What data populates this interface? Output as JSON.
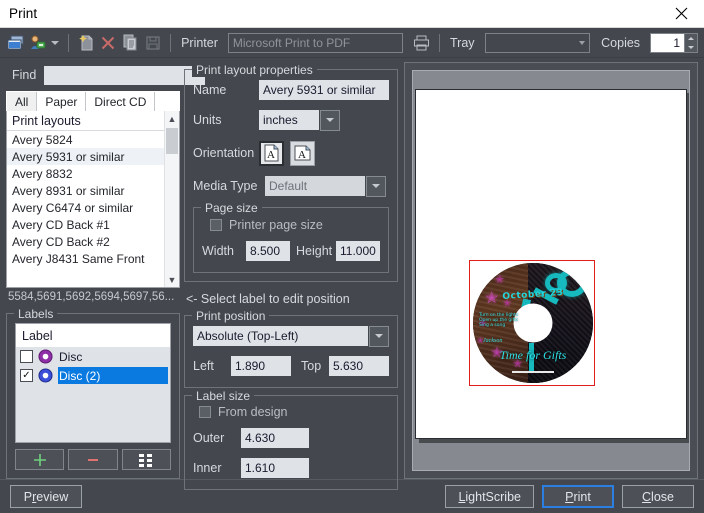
{
  "window": {
    "title": "Print",
    "close_icon": "close-icon"
  },
  "toolbar": {
    "icons": [
      {
        "name": "layout-windows-icon",
        "glyph": "❐"
      },
      {
        "name": "user-settings-icon",
        "glyph": "☺"
      },
      {
        "name": "dropdown-caret-icon",
        "glyph": "▼"
      },
      {
        "name": "new-document-icon",
        "glyph": "🗋"
      },
      {
        "name": "delete-icon",
        "glyph": "✕"
      },
      {
        "name": "copy-icon",
        "glyph": "⧉"
      },
      {
        "name": "save-icon",
        "glyph": "💾"
      }
    ],
    "printer_label": "Printer",
    "printer_value": "Microsoft Print to PDF",
    "print_icon": "printer-icon",
    "tray_label": "Tray",
    "tray_value": "",
    "copies_label": "Copies",
    "copies_value": "1"
  },
  "left": {
    "find_label": "Find",
    "find_value": "",
    "find_placeholder": "",
    "tabs": [
      {
        "label": "All",
        "active": true
      },
      {
        "label": "Paper",
        "active": false
      },
      {
        "label": "Direct CD",
        "active": false
      }
    ],
    "list_header": "Print layouts",
    "layouts": [
      "Avery 5824",
      "Avery 5931 or similar",
      "Avery 8832",
      "Avery 8931 or similar",
      "Avery C6474 or similar",
      "Avery CD Back #1",
      "Avery CD Back #2",
      "Avery J8431 Same Front"
    ],
    "selected_layout": "Avery 5931 or similar",
    "list_footer": "5584,5691,5692,5694,5697,56...",
    "labels_legend": "Labels",
    "labels_header": "Label",
    "labels": [
      {
        "name": "Disc",
        "checked": false,
        "selected": false
      },
      {
        "name": "Disc (2)",
        "checked": true,
        "selected": true
      }
    ],
    "label_buttons": [
      {
        "name": "add-label-button",
        "glyph": "+"
      },
      {
        "name": "remove-label-button",
        "glyph": "–"
      },
      {
        "name": "arrange-labels-button",
        "glyph": "▦"
      }
    ],
    "accent_selection": "#0a7ae0"
  },
  "properties": {
    "legend": "Print layout properties",
    "name_label": "Name",
    "name_value": "Avery 5931 or similar",
    "units_label": "Units",
    "units_value": "inches",
    "orientation_label": "Orientation",
    "orientation_options": [
      {
        "name": "orientation-portrait-button",
        "selected": true
      },
      {
        "name": "orientation-landscape-button",
        "selected": false
      }
    ],
    "media_type_label": "Media Type",
    "media_type_value": "Default",
    "page_size_legend": "Page size",
    "printer_page_size_label": "Printer page size",
    "printer_page_size_checked": false,
    "width_label": "Width",
    "width_value": "8.500",
    "height_label": "Height",
    "height_value": "11.000"
  },
  "position": {
    "hint": "<- Select label to edit position",
    "legend": "Print position",
    "mode_value": "Absolute (Top-Left)",
    "left_label": "Left",
    "left_value": "1.890",
    "top_label": "Top",
    "top_value": "5.630",
    "size_legend": "Label size",
    "from_design_label": "From design",
    "from_design_checked": false,
    "outer_label": "Outer",
    "outer_value": "4.630",
    "inner_label": "Inner",
    "inner_value": "1.610"
  },
  "preview": {
    "label_border_color": "#e11d1d",
    "cd_top_text": "October 23",
    "cd_bottom_text": "Time for Gifts",
    "cd_block_text": "Turn on the lights\nOpen up the gifts\nSing a song",
    "cd_signature": "Jackson"
  },
  "footer": {
    "preview_button": "Preview",
    "preview_accel": "r",
    "lightscribe_button": "LightScribe",
    "lightscribe_accel": "L",
    "print_button": "Print",
    "print_accel": "P",
    "close_button": "Close",
    "close_accel": "C"
  }
}
